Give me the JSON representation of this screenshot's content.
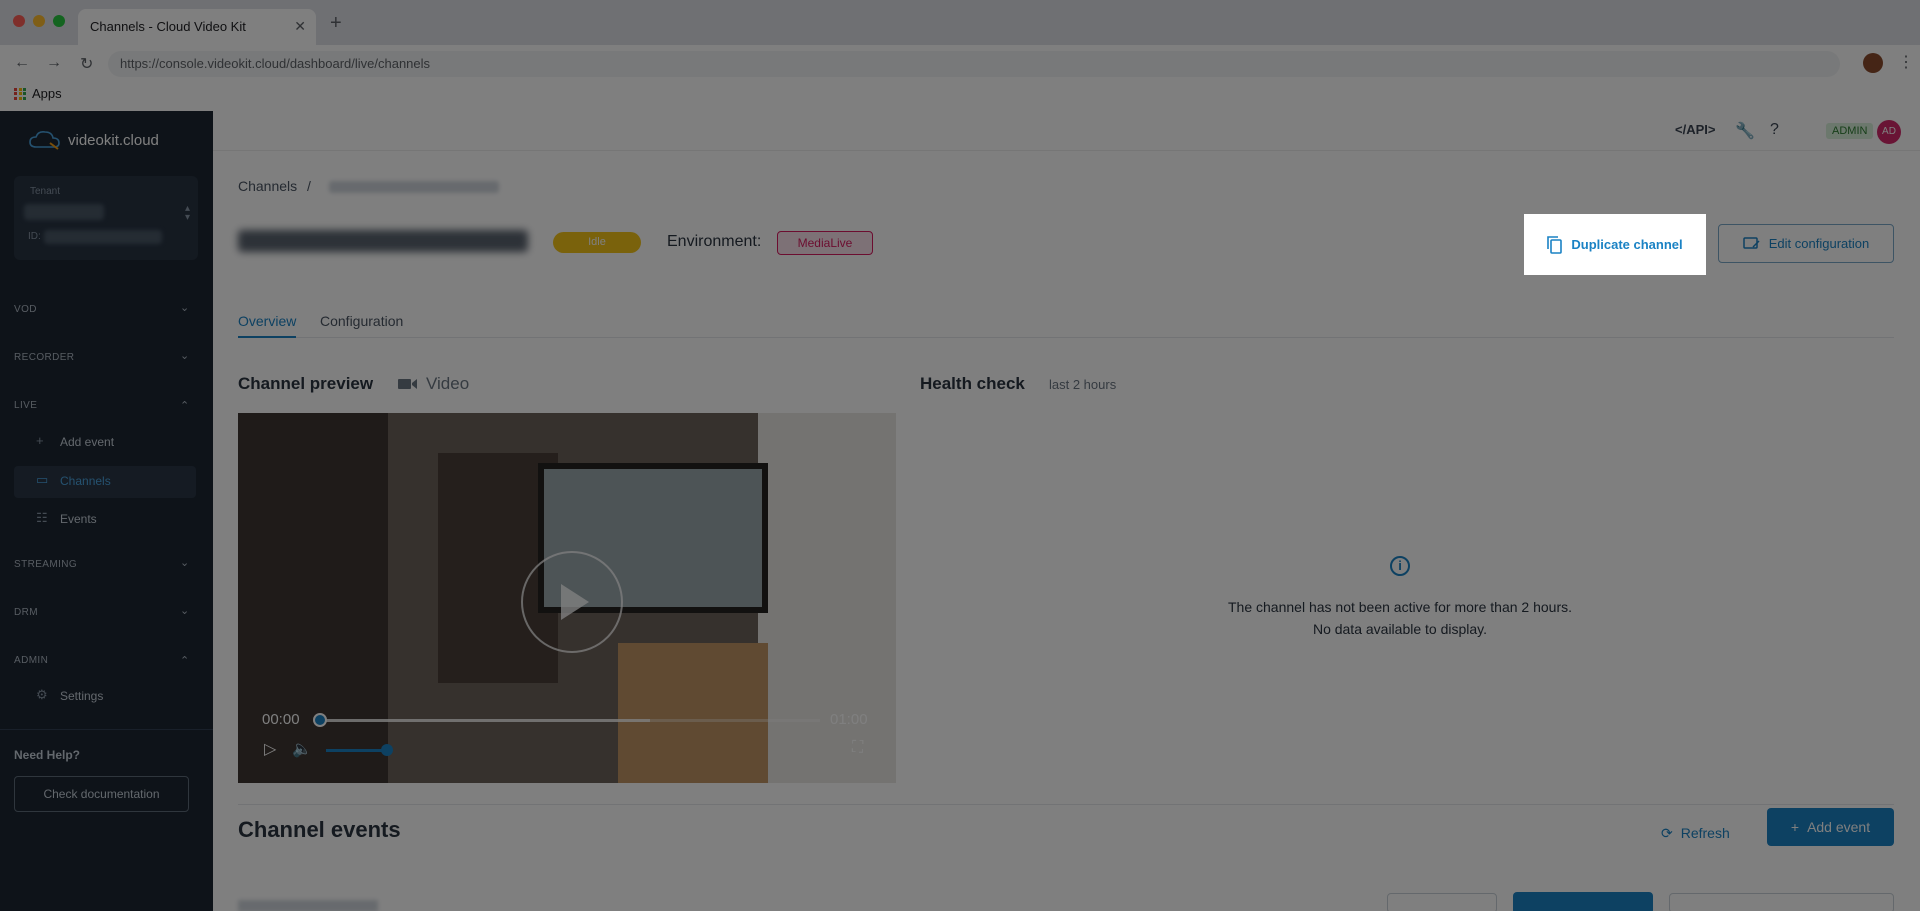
{
  "browser": {
    "tab_title": "Channels - Cloud Video Kit",
    "url": "https://console.videokit.cloud/dashboard/live/channels",
    "bookmarks_apps": "Apps"
  },
  "sidebar": {
    "logo": "videokit.cloud",
    "tenant_label": "Tenant",
    "id_label": "ID:",
    "sections": {
      "vod": "VOD",
      "recorder": "RECORDER",
      "live": "LIVE",
      "streaming": "STREAMING",
      "drm": "DRM",
      "admin": "ADMIN"
    },
    "live_items": [
      "Add event",
      "Channels",
      "Events"
    ],
    "admin_items": [
      "Settings"
    ],
    "help_title": "Need Help?",
    "doc_button": "Check documentation"
  },
  "topbar": {
    "api": "</API>",
    "admin_badge": "ADMIN",
    "avatar": "AD"
  },
  "page": {
    "breadcrumb_root": "Channels",
    "breadcrumb_sep": "/",
    "status": "Idle",
    "environment_label": "Environment:",
    "environment_value": "MediaLive",
    "duplicate_button": "Duplicate channel",
    "edit_button": "Edit configuration",
    "tabs": [
      "Overview",
      "Configuration"
    ]
  },
  "preview": {
    "title": "Channel preview",
    "type": "Video",
    "time_current": "00:00",
    "time_total": "01:00",
    "progress": 0
  },
  "health": {
    "title": "Health check",
    "range": "last 2 hours",
    "message_line1": "The channel has not been active for more than 2 hours.",
    "message_line2": "No data available to display."
  },
  "events": {
    "title": "Channel events",
    "refresh": "Refresh",
    "add": "Add event"
  },
  "colors": {
    "accent": "#1a82c4",
    "sidebar": "#1d2733",
    "idle": "#f5c518",
    "medialive": "#d81b60"
  }
}
